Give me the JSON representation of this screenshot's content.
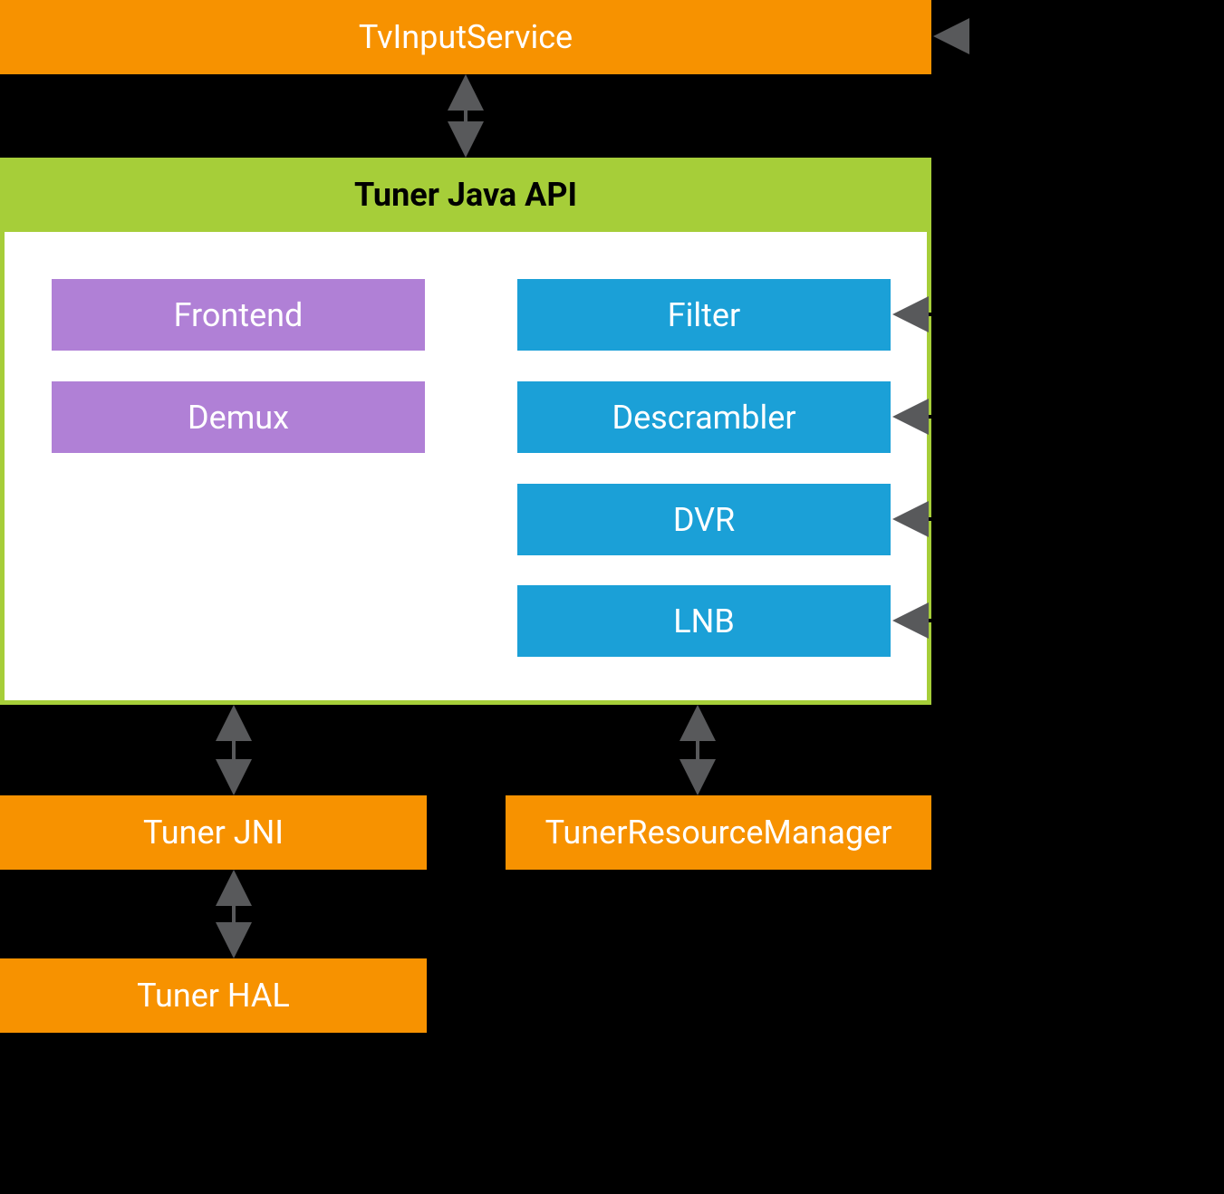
{
  "blocks": {
    "tv_input_service": "TvInputService",
    "tuner_java_api": "Tuner Java API",
    "frontend": "Frontend",
    "demux": "Demux",
    "filter": "Filter",
    "descrambler": "Descrambler",
    "dvr": "DVR",
    "lnb": "LNB",
    "tuner_jni": "Tuner JNI",
    "tuner_resource_manager": "TunerResourceManager",
    "tuner_hal": "Tuner HAL"
  },
  "colors": {
    "orange": "#F79200",
    "green": "#A6CE39",
    "purple": "#B080D6",
    "blue": "#1BA0D7",
    "arrow": "#58595B"
  }
}
